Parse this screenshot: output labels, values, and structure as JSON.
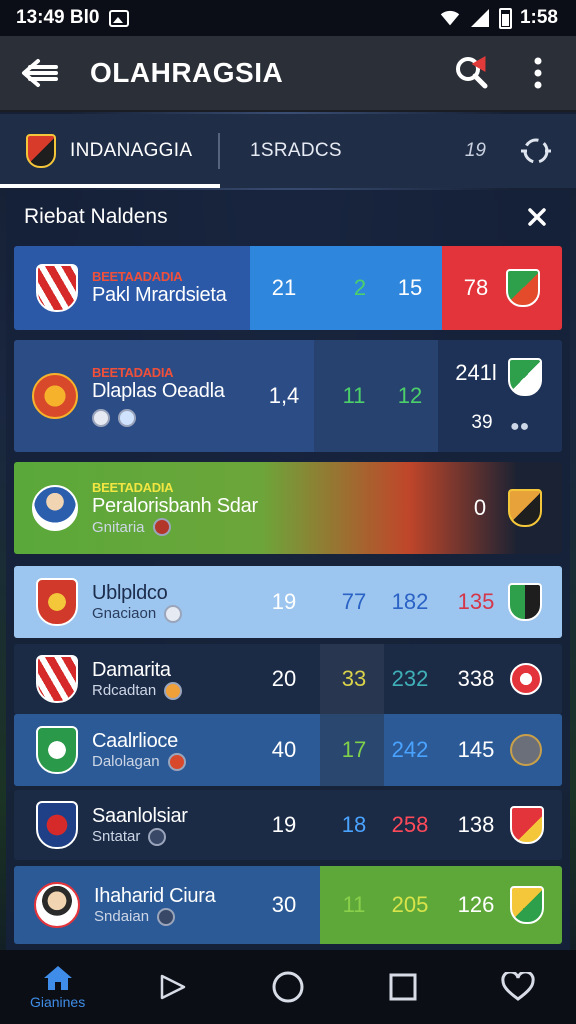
{
  "status_bar": {
    "time_left": "13:49 Bl0",
    "time_right": "1:58"
  },
  "app_bar": {
    "title": "OLAHRAGSIA"
  },
  "tabs": [
    {
      "label": "INDANAGGIA"
    },
    {
      "label": "1SRADCS"
    }
  ],
  "tabs_count": "19",
  "panel": {
    "title": "Riebat Naldens"
  },
  "rows": [
    {
      "league": "BEETAADADIA",
      "name": "Pakl Mrardsieta",
      "sub": "",
      "stats": [
        "21",
        "2",
        "15",
        "78"
      ]
    },
    {
      "league": "BEETADADIA",
      "name": "Dlaplas Oeadla",
      "sub": "",
      "stats": [
        "1,4",
        "11",
        "12",
        "241l",
        "39"
      ]
    },
    {
      "league": "BEETADADIA",
      "name": "Peralorisbanh Sdar",
      "sub": "Gnitaria",
      "stats": [
        "0"
      ]
    },
    {
      "league": "",
      "name": "Ublpldco",
      "sub": "Gnaciaon",
      "stats": [
        "19",
        "77",
        "182",
        "135"
      ]
    },
    {
      "league": "",
      "name": "Damarita",
      "sub": "Rdcadtan",
      "stats": [
        "20",
        "33",
        "232",
        "338"
      ]
    },
    {
      "league": "",
      "name": "Caalrlioce",
      "sub": "Dalolagan",
      "stats": [
        "40",
        "17",
        "242",
        "145"
      ]
    },
    {
      "league": "",
      "name": "Saanlolsiar",
      "sub": "Sntatar",
      "stats": [
        "19",
        "18",
        "258",
        "138"
      ]
    },
    {
      "league": "",
      "name": "Ihaharid Ciura",
      "sub": "Sndaian",
      "stats": [
        "30",
        "11",
        "205",
        "126"
      ]
    }
  ],
  "nav": {
    "home_label": "Gianines"
  },
  "colors": {
    "accent_blue": "#2f7fd6",
    "accent_red": "#e3343b",
    "accent_green": "#5ea83a",
    "stat_green": "#4cd06a",
    "stat_blue": "#4aa3ff",
    "stat_red": "#ff4a5a"
  }
}
